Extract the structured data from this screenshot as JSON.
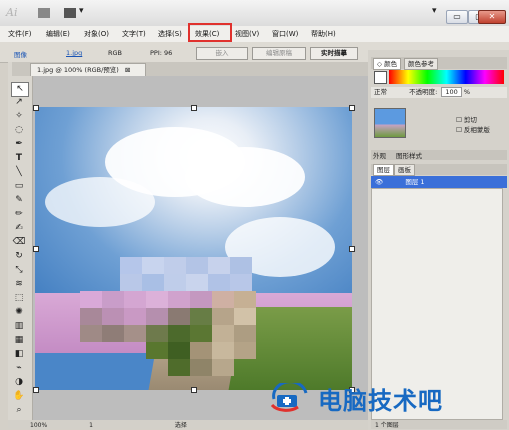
{
  "app": {
    "logo": "Ai"
  },
  "menu": [
    "文件(F)",
    "编辑(E)",
    "对象(O)",
    "文字(T)",
    "选择(S)",
    "效果(C)",
    "视图(V)",
    "窗口(W)",
    "帮助(H)"
  ],
  "control_bar": {
    "image_label": "图像",
    "file_link": "1.jpg",
    "color_mode": "RGB",
    "ppi": "PPI: 96",
    "embed_button": "嵌入",
    "edit_original_button": "编辑原稿",
    "live_trace_button": "实时描摹"
  },
  "document_tab": {
    "title": "1.jpg @ 100% (RGB/预览)",
    "close": "⊠"
  },
  "panels": {
    "color_tab": "◇ 颜色",
    "color_guide_tab": "颜色参考",
    "blend_mode": "正常",
    "opacity_label": "不透明度:",
    "opacity_value": "100",
    "percent": "%",
    "clip_label": "剪切",
    "invert_mask_label": "反相蒙版",
    "appearance_tab": "外观",
    "graphic_styles_tab": "图形样式",
    "layers_tab": "图层",
    "artboards_tab": "画板",
    "layer_name": "图层 1",
    "layers_count": "1 个图层"
  },
  "status": {
    "zoom": "100%",
    "page": "1",
    "mode": "选择"
  },
  "watermark": {
    "text": "电脑技术吧"
  },
  "colors": {
    "highlight": "#e0312d",
    "layer_selected": "#3a6fd9",
    "watermark": "#1769c2"
  }
}
